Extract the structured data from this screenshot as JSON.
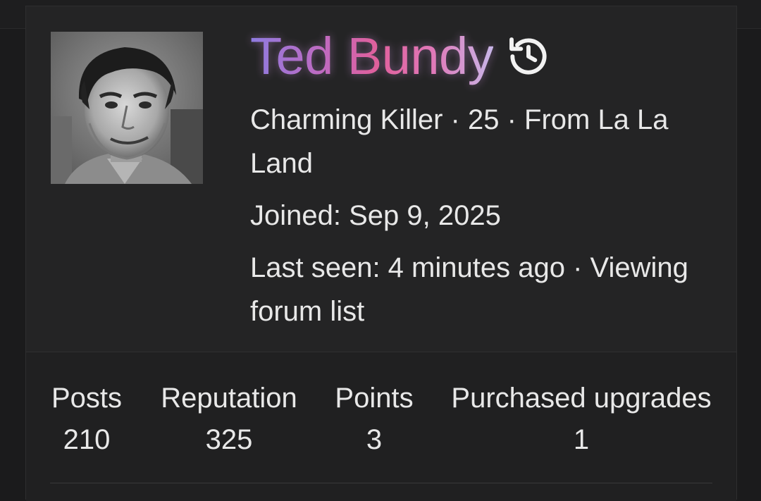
{
  "profile": {
    "username": "Ted Bundy",
    "custom_title": "Charming Killer",
    "age": "25",
    "location": "From La La Land",
    "title_line": "Charming Killer · 25 · From La La Land",
    "joined": "Joined: Sep 9, 2025",
    "last_seen": "Last seen: 4 minutes ago · Viewing forum list",
    "history_icon": "history-icon",
    "avatar_icon": "avatar-photo"
  },
  "stats": [
    {
      "label": "Posts",
      "value": "210"
    },
    {
      "label": "Reputation",
      "value": "325"
    },
    {
      "label": "Points",
      "value": "3"
    },
    {
      "label": "Purchased upgrades",
      "value": "1"
    }
  ],
  "colors": {
    "background": "#1b1b1c",
    "card": "#242425",
    "text": "#e8e8e8",
    "name_gradient": [
      "#8e7be0",
      "#e0609c",
      "#c8b6e8"
    ]
  }
}
